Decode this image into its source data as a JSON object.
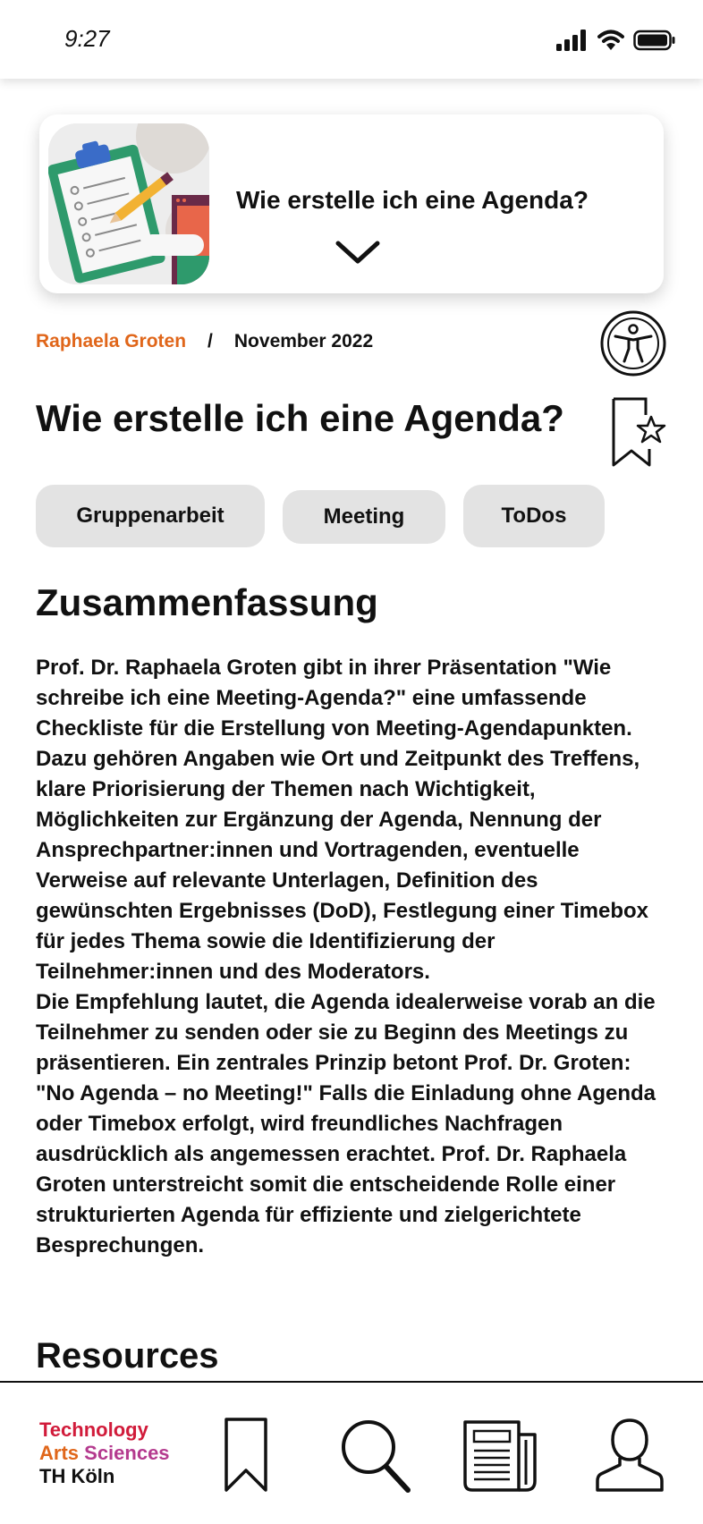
{
  "status_bar": {
    "time": "9:27"
  },
  "hero": {
    "title": "Wie erstelle ich eine Agenda?"
  },
  "meta": {
    "author": "Raphaela Groten",
    "separator": "/",
    "date": "November 2022"
  },
  "page_title": "Wie erstelle ich eine Agenda?",
  "tags": [
    "Gruppenarbeit",
    "Meeting",
    "ToDos"
  ],
  "summary": {
    "heading": "Zusammenfassung",
    "paragraph_1": "Prof. Dr. Raphaela Groten gibt in ihrer Präsentation \"Wie schreibe ich eine Meeting-Agenda?\" eine umfassende Checkliste für die Erstellung von Meeting-Agendapunkten. Dazu gehören Angaben wie Ort und Zeitpunkt des Treffens, klare Priorisierung der Themen nach Wichtigkeit, Möglichkeiten zur Ergänzung der Agenda, Nennung der Ansprechpartner:innen und Vortragenden, eventuelle Verweise auf relevante Unterlagen, Definition des gewünschten Ergebnisses (DoD), Festlegung einer Timebox für jedes Thema sowie die Identifizierung der Teilnehmer:innen und des Moderators.",
    "paragraph_2": "Die Empfehlung lautet, die Agenda idealerweise vorab an die Teilnehmer zu senden oder sie zu Beginn des Meetings zu präsentieren. Ein zentrales Prinzip betont Prof. Dr. Groten: \"No Agenda – no Meeting!\" Falls die Einladung ohne Agenda oder Timebox erfolgt, wird freundliches Nachfragen ausdrücklich als angemessen erachtet. Prof. Dr. Raphaela Groten unterstreicht somit die entscheidende Rolle einer strukturierten Agenda für effiziente und zielgerichtete Besprechungen."
  },
  "resources_heading": "Resources",
  "brand": {
    "line1": "Technology",
    "line2_a": "Arts",
    "line2_b": "Sciences",
    "line3": "TH Köln"
  },
  "colors": {
    "accent_orange": "#e0661a",
    "brand_red": "#d11b3a",
    "brand_purple": "#b43a8e",
    "tag_bg": "#e3e3e3"
  },
  "icons": {
    "status": [
      "signal-icon",
      "wifi-icon",
      "battery-icon"
    ],
    "actions": [
      "accessibility-icon",
      "bookmark-star-icon",
      "chevron-down-icon"
    ],
    "nav": [
      "bookmark-icon",
      "search-icon",
      "news-icon",
      "profile-icon"
    ]
  }
}
